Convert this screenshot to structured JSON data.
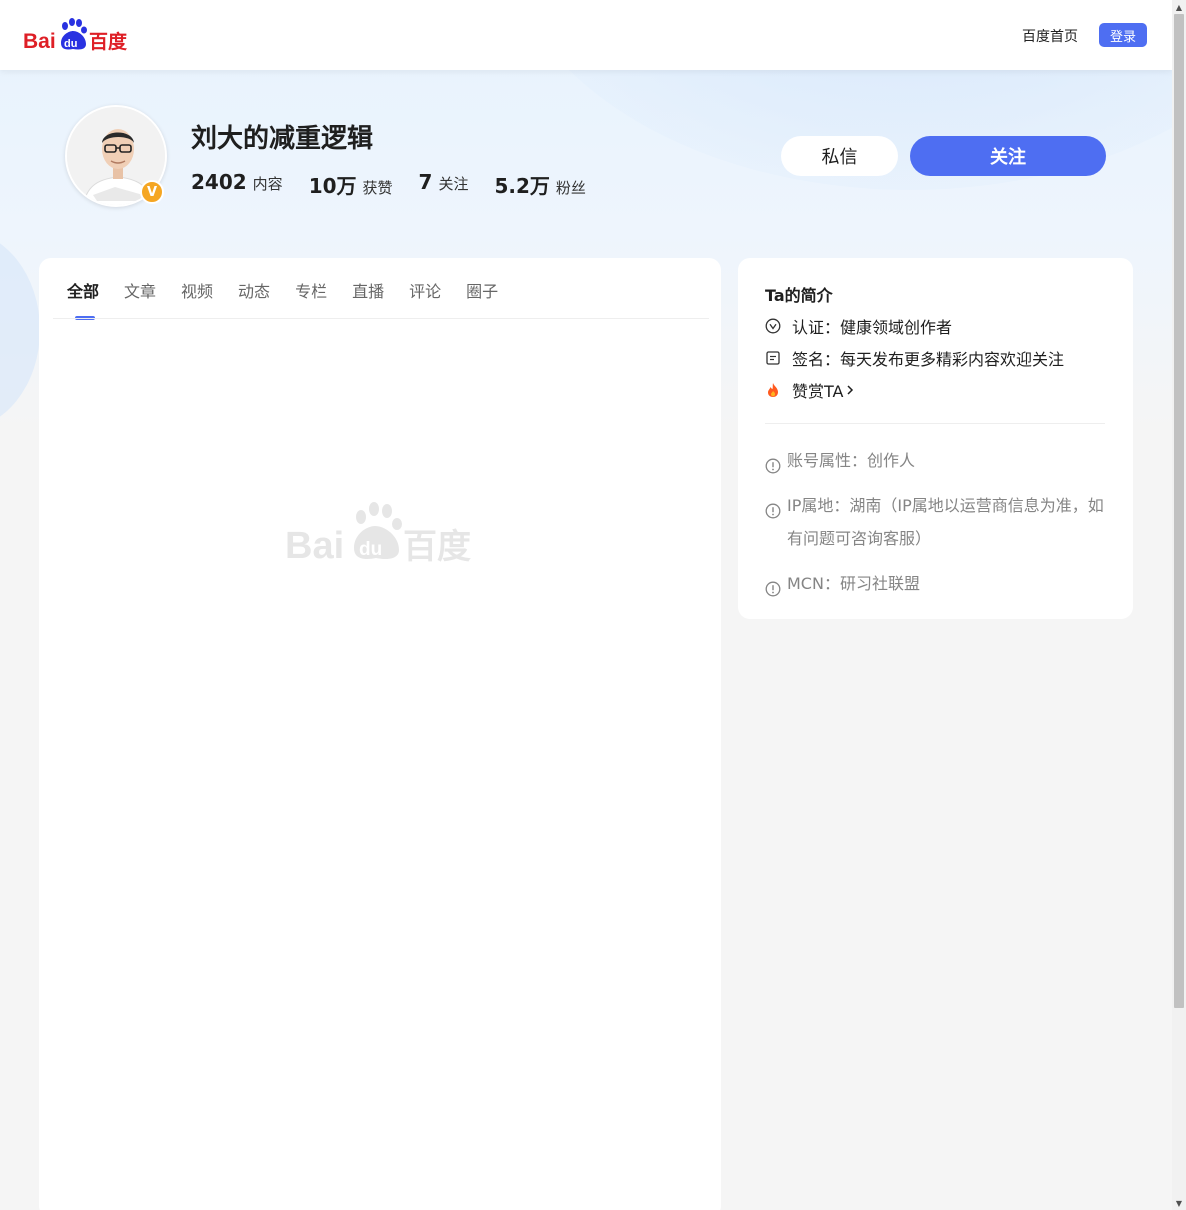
{
  "header": {
    "home_link": "百度首页",
    "login_label": "登录",
    "brand_color": "#4e6ef2"
  },
  "profile": {
    "name": "刘大的减重逻辑",
    "verified_badge": "V",
    "stats": [
      {
        "num": "2402",
        "label": "内容"
      },
      {
        "num": "10万",
        "label": "获赞"
      },
      {
        "num": "7",
        "label": "关注"
      },
      {
        "num": "5.2万",
        "label": "粉丝"
      }
    ],
    "message_label": "私信",
    "follow_label": "关注"
  },
  "tabs": [
    "全部",
    "文章",
    "视频",
    "动态",
    "专栏",
    "直播",
    "评论",
    "圈子"
  ],
  "intro": {
    "title": "Ta的简介",
    "certification": "认证：健康领域创作者",
    "signature": "签名：每天发布更多精彩内容欢迎关注",
    "reward": "赞赏TA",
    "account_type": "账号属性：创作人",
    "ip_location": "IP属地：湖南（IP属地以运营商信息为准，如有问题可咨询客服）",
    "mcn": "MCN：研习社联盟"
  },
  "icons": {
    "logo": "baidu-logo",
    "cert": "check-circle-icon",
    "signature": "note-icon",
    "reward": "fire-icon",
    "info": "exclamation-circle-icon"
  }
}
